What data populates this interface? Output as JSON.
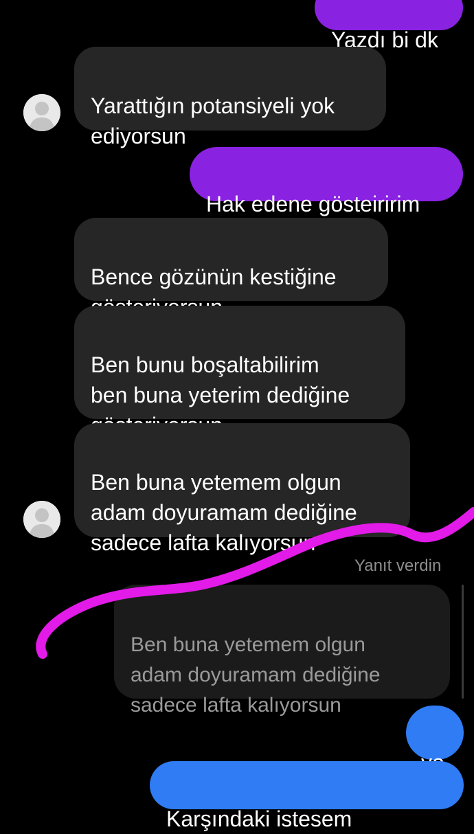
{
  "messages": {
    "m0": "Yazdı bi dk",
    "m1": "Yarattığın potansiyeli yok\nediyorsun",
    "m2": "Hak edene gösteiririm",
    "m3": "Bence gözünün kestiğine\ngösteriyorsun",
    "m4": "Ben bunu boşaltabilirim\nben buna yeterim dediğine\ngösteriyorsun",
    "m5": "Ben buna yetemem olgun\nadam doyuramam dediğine\nsadece lafta kalıyorsun",
    "m6": "yo",
    "m7": "Karşındaki istesem"
  },
  "reply": {
    "label": "Yanıt verdin",
    "quote": "Ben buna yetemem olgun\nadam doyuramam dediğine\nsadece lafta kalıyorsun"
  },
  "colors": {
    "outgoing_bubble": "#8a22e2",
    "incoming_bubble": "#262626",
    "sent_blue_bubble": "#2f7cf5",
    "scribble": "#e21be8"
  }
}
